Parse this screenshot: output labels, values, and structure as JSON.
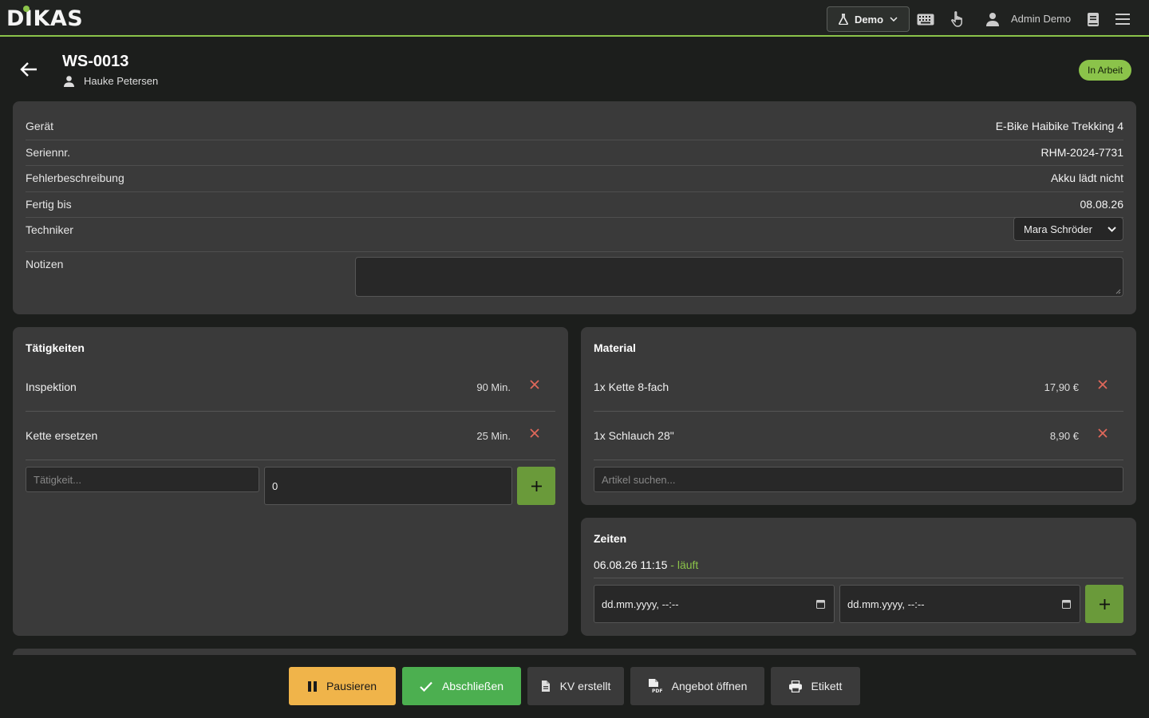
{
  "app": {
    "logo": "DIKAS"
  },
  "topbar": {
    "demo_label": "Demo",
    "user_name": "Admin Demo",
    "icons": [
      "flask-icon",
      "chevron-down-icon",
      "keyboard-icon",
      "pointer-hand-icon",
      "user-icon",
      "book-icon",
      "menu-icon"
    ]
  },
  "header": {
    "order_id": "WS-0013",
    "customer": "Hauke Petersen",
    "status": "In Arbeit"
  },
  "info": {
    "device_label": "Gerät",
    "device_value": "E-Bike Haibike Trekking 4",
    "serial_label": "Seriennr.",
    "serial_value": "RHM-2024-7731",
    "fault_label": "Fehlerbeschreibung",
    "fault_value": "Akku lädt nicht",
    "due_label": "Fertig bis",
    "due_value": "08.08.26",
    "tech_label": "Techniker",
    "tech_value": "Mara Schröder",
    "notes_label": "Notizen"
  },
  "activities": {
    "title": "Tätigkeiten",
    "items": [
      {
        "name": "Inspektion",
        "duration": "90 Min."
      },
      {
        "name": "Kette ersetzen",
        "duration": "25 Min."
      }
    ],
    "input_placeholder": "Tätigkeit...",
    "minutes_value": "0"
  },
  "material": {
    "title": "Material",
    "items": [
      {
        "name": "1x Kette 8-fach",
        "price": "17,90 €"
      },
      {
        "name": "1x Schlauch 28\"",
        "price": "8,90 €"
      }
    ],
    "search_placeholder": "Artikel suchen..."
  },
  "times": {
    "title": "Zeiten",
    "entry_start": "06.08.26 11:15",
    "entry_sep": " - ",
    "entry_status": "läuft",
    "from_placeholder": "dd.mm.yyyy, --:--",
    "to_placeholder": "dd.mm.yyyy, --:--"
  },
  "actions": {
    "pause": "Pausieren",
    "complete": "Abschließen",
    "estimate": "KV erstellt",
    "offer": "Angebot öffnen",
    "label": "Etikett"
  },
  "colors": {
    "accent": "#8bc34a",
    "warning": "#f0b44a",
    "success": "#4caf50",
    "danger": "#e0685a"
  }
}
